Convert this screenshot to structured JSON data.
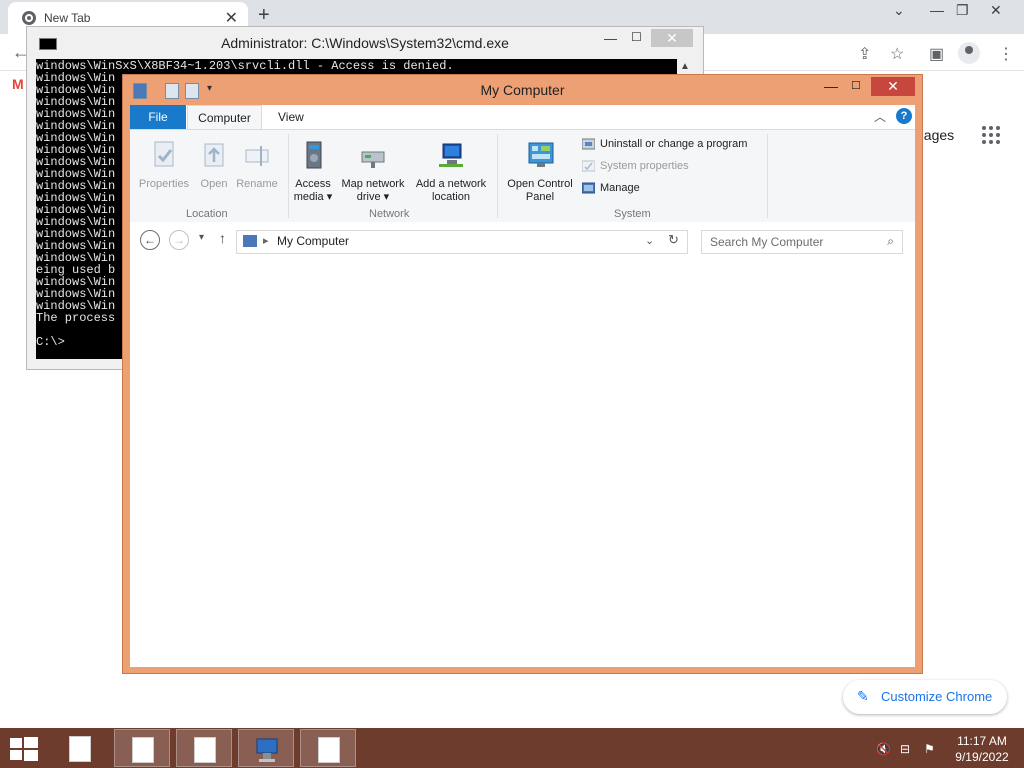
{
  "chrome": {
    "tab_title": "New Tab",
    "tab_close": "✕",
    "new_tab": "+",
    "images_link": "nages",
    "customize_label": "Customize Chrome"
  },
  "cmd": {
    "title": "Administrator: C:\\Windows\\System32\\cmd.exe",
    "lines": [
      "windows\\WinSxS\\X8BF34~1.203\\srvcli.dll - Access is denied.",
      "windows\\Win",
      "windows\\Win",
      "windows\\Win",
      "windows\\Win",
      "windows\\Win",
      "windows\\Win",
      "windows\\Win",
      "windows\\Win",
      "windows\\Win",
      "windows\\Win",
      "windows\\Win",
      "windows\\Win",
      "windows\\Win",
      "windows\\Win",
      "windows\\Win",
      "windows\\Win",
      "eing used b",
      "windows\\Win",
      "windows\\Win",
      "windows\\Win",
      "The process",
      "",
      "C:\\>"
    ]
  },
  "explorer": {
    "title": "My Computer",
    "tabs": {
      "file": "File",
      "computer": "Computer",
      "view": "View"
    },
    "help": "?",
    "ribbon": {
      "location": {
        "label": "Location",
        "properties": "Properties",
        "open": "Open",
        "rename": "Rename"
      },
      "network": {
        "label": "Network",
        "access_media_1": "Access",
        "access_media_2": "media ▾",
        "map_drive_1": "Map network",
        "map_drive_2": "drive ▾",
        "add_location_1": "Add a network",
        "add_location_2": "location"
      },
      "system": {
        "label": "System",
        "control_panel_1": "Open Control",
        "control_panel_2": "Panel",
        "uninstall": "Uninstall or change a program",
        "system_properties": "System properties",
        "manage": "Manage"
      }
    },
    "address": {
      "path": "My Computer"
    },
    "search": {
      "placeholder": "Search My Computer"
    }
  },
  "taskbar": {
    "clock_time": "11:17 AM",
    "clock_date": "9/19/2022"
  },
  "colors": {
    "explorer_frame": "#eda074",
    "taskbar": "#6e3c2c",
    "ribbon_file_tab": "#1979ca",
    "close_button": "#c7463d",
    "chrome_accent": "#1a73e8"
  },
  "icons": [
    "chrome-logo-icon",
    "gmail-icon",
    "share-icon",
    "star-icon",
    "sidebar-icon",
    "profile-icon",
    "kebab-menu-icon",
    "apps-grid-icon",
    "pencil-icon",
    "cmd-icon",
    "windows-start-icon",
    "speaker-muted-icon",
    "network-icon",
    "flag-icon"
  ]
}
